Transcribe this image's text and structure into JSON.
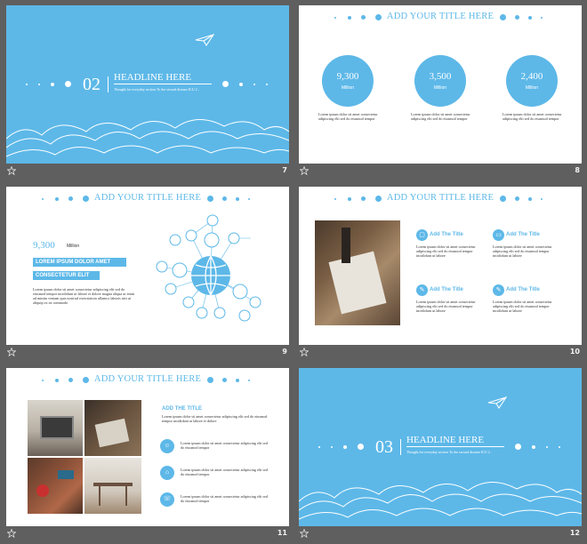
{
  "slides": [
    {
      "number": "7",
      "section_num": "02",
      "headline": "HEADLINE HERE",
      "subtitle": "Thought for everyday section To the second disease ICU 2 ․"
    },
    {
      "number": "8",
      "title": "ADD YOUR TITLE HERE",
      "stats": [
        {
          "value": "9,300",
          "unit": "Million",
          "desc": "Lorem ipsum dolor sit amet consectetur adipiscing elit sed do eiusmod tempor"
        },
        {
          "value": "3,500",
          "unit": "Million",
          "desc": "Lorem ipsum dolor sit amet consectetur adipiscing elit sed do eiusmod tempor"
        },
        {
          "value": "2,400",
          "unit": "Million",
          "desc": "Lorem ipsum dolor sit amet consectetur adipiscing elit sed do eiusmod tempor"
        }
      ]
    },
    {
      "number": "9",
      "title": "ADD YOUR TITLE HERE",
      "stat_value": "9,300",
      "stat_unit": "Million",
      "label1": "LOREM IPSUM DOLOR AMET",
      "label2": "CONSECTETUR ELIT",
      "body": "Lorem ipsum dolor sit amet consectetur adipiscing elit sed do eiusmod tempor incididunt ut labore et dolore magna aliqua ut enim ad minim veniam quis nostrud exercitation ullamco laboris nisi ut aliquip ex ea commodo"
    },
    {
      "number": "10",
      "title": "ADD YOUR TITLE HERE",
      "items": [
        {
          "title": "Add The Title",
          "text": "Lorem ipsum dolor sit amet consectetur adipiscing elit sed do eiusmod tempor incididunt ut labore"
        },
        {
          "title": "Add The Title",
          "text": "Lorem ipsum dolor sit amet consectetur adipiscing elit sed do eiusmod tempor incididunt ut labore"
        },
        {
          "title": "Add The Title",
          "text": "Lorem ipsum dolor sit amet consectetur adipiscing elit sed do eiusmod tempor incididunt ut labore"
        },
        {
          "title": "Add The Title",
          "text": "Lorem ipsum dolor sit amet consectetur adipiscing elit sed do eiusmod tempor incididunt ut labore"
        }
      ]
    },
    {
      "number": "11",
      "title": "ADD YOUR TITLE HERE",
      "sub_title": "ADD THE TITLE",
      "sub_text": "Lorem ipsum dolor sit amet consectetur adipiscing elit sed do eiusmod tempor incididunt ut labore et dolore",
      "rows": [
        {
          "text": "Lorem ipsum dolor sit amet consectetur adipiscing elit sed do eiusmod tempor"
        },
        {
          "text": "Lorem ipsum dolor sit amet consectetur adipiscing elit sed do eiusmod tempor"
        },
        {
          "text": "Lorem ipsum dolor sit amet consectetur adipiscing elit sed do eiusmod tempor"
        }
      ]
    },
    {
      "number": "12",
      "section_num": "03",
      "headline": "HEADLINE HERE",
      "subtitle": "Thought for everyday section To the second disease ICU 2 ․"
    }
  ],
  "colors": {
    "accent": "#5db8e8",
    "background": "#5f5f5f"
  },
  "icons": {
    "paper_plane": "paper-plane-icon",
    "star": "star-icon",
    "globe": "globe-icon",
    "user": "user-icon"
  }
}
